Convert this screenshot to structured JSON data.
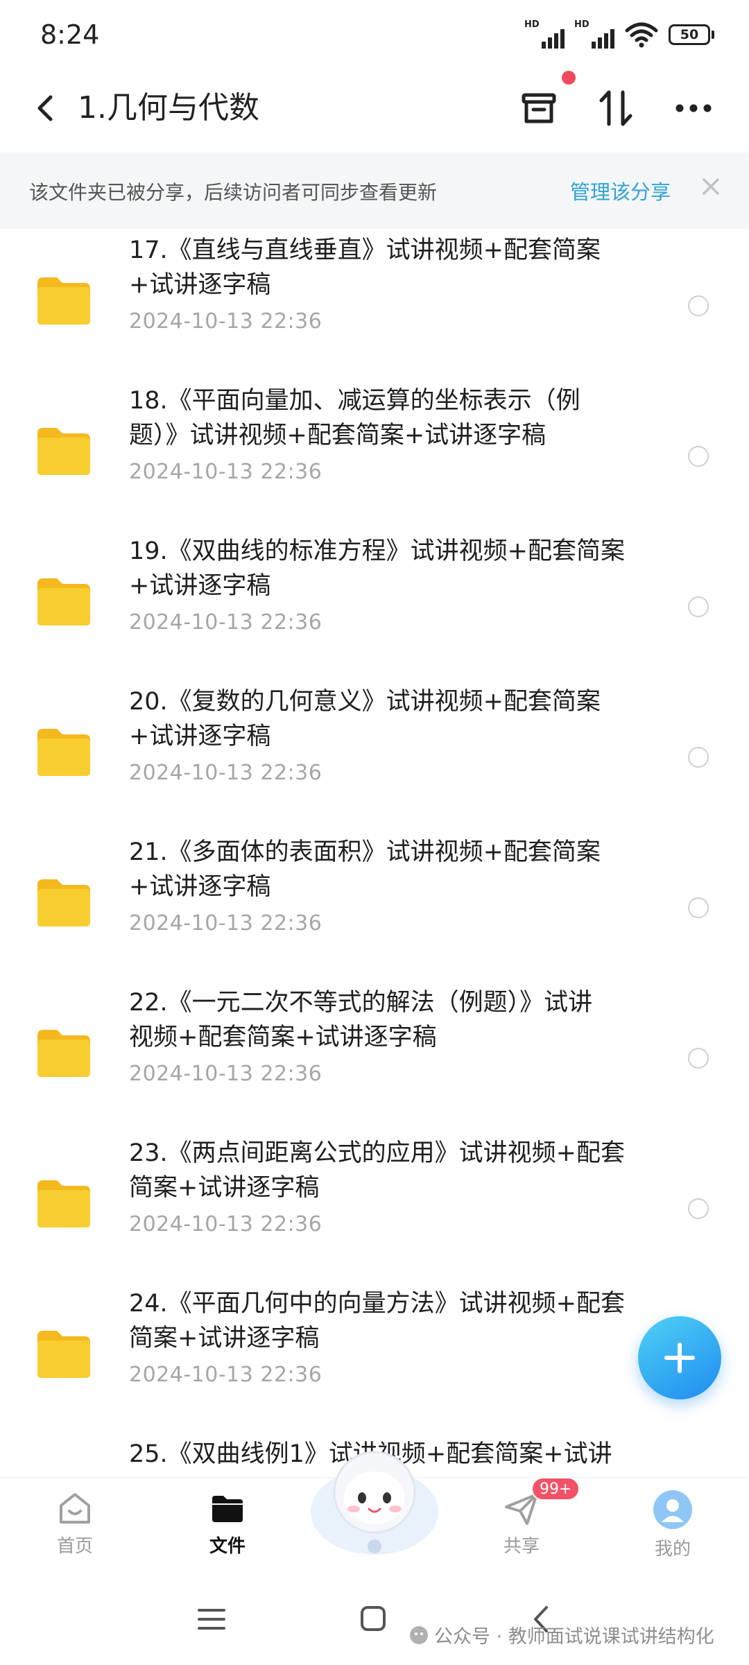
{
  "status_bar": {
    "time": "8:24",
    "signal1_label": "HD",
    "signal2_label": "HD",
    "battery": "50"
  },
  "header": {
    "title": "1.几何与代数",
    "back_icon": "chevron-left-icon",
    "trash_icon": "trash-icon",
    "sort_icon": "sort-icon",
    "more_icon": "more-icon"
  },
  "share_banner": {
    "message": "该文件夹已被分享，后续访问者可同步查看更新",
    "manage_link": "管理该分享",
    "close_icon": "close-icon"
  },
  "files": [
    {
      "name_line1": "17.《直线与直线垂直》试讲视频+配套简案",
      "name_line2": "+试讲逐字稿",
      "date": "2024-10-13  22:36"
    },
    {
      "name_line1": "18.《平面向量加、减运算的坐标表示（例",
      "name_line2": "题）》试讲视频+配套简案+试讲逐字稿",
      "date": "2024-10-13  22:36"
    },
    {
      "name_line1": "19.《双曲线的标准方程》试讲视频+配套简案",
      "name_line2": "+试讲逐字稿",
      "date": "2024-10-13  22:36"
    },
    {
      "name_line1": "20.《复数的几何意义》试讲视频+配套简案",
      "name_line2": "+试讲逐字稿",
      "date": "2024-10-13  22:36"
    },
    {
      "name_line1": "21.《多面体的表面积》试讲视频+配套简案",
      "name_line2": "+试讲逐字稿",
      "date": "2024-10-13  22:36"
    },
    {
      "name_line1": "22.《一元二次不等式的解法（例题）》试讲",
      "name_line2": "视频+配套简案+试讲逐字稿",
      "date": "2024-10-13  22:36"
    },
    {
      "name_line1": "23.《两点间距离公式的应用》试讲视频+配套",
      "name_line2": "简案+试讲逐字稿",
      "date": "2024-10-13  22:36"
    },
    {
      "name_line1": "24.《平面几何中的向量方法》试讲视频+配套",
      "name_line2": "简案+试讲逐字稿",
      "date": "2024-10-13  22:36"
    },
    {
      "name_line1": "25.《双曲线例1》试讲视频+配套简案+试讲",
      "name_line2": "",
      "date": ""
    }
  ],
  "fab": {
    "icon": "plus-icon"
  },
  "bottom_nav": {
    "items": [
      {
        "label": "首页",
        "icon": "home-icon"
      },
      {
        "label": "文件",
        "icon": "folder-icon"
      },
      {
        "label": "共享",
        "icon": "send-icon"
      },
      {
        "label": "我的",
        "icon": "avatar-icon"
      }
    ],
    "share_badge": "99+"
  },
  "system_nav": {
    "menu_icon": "menu-icon",
    "home_icon": "square-icon",
    "back_icon": "back-icon"
  },
  "watermark": "公众号 · 教师面试说课试讲结构化",
  "colors": {
    "accent": "#2fa3d6",
    "fab_start": "#4fd1f5",
    "fab_end": "#1f8cf0",
    "badge": "#f25268",
    "folder": "#f8cd2f"
  }
}
